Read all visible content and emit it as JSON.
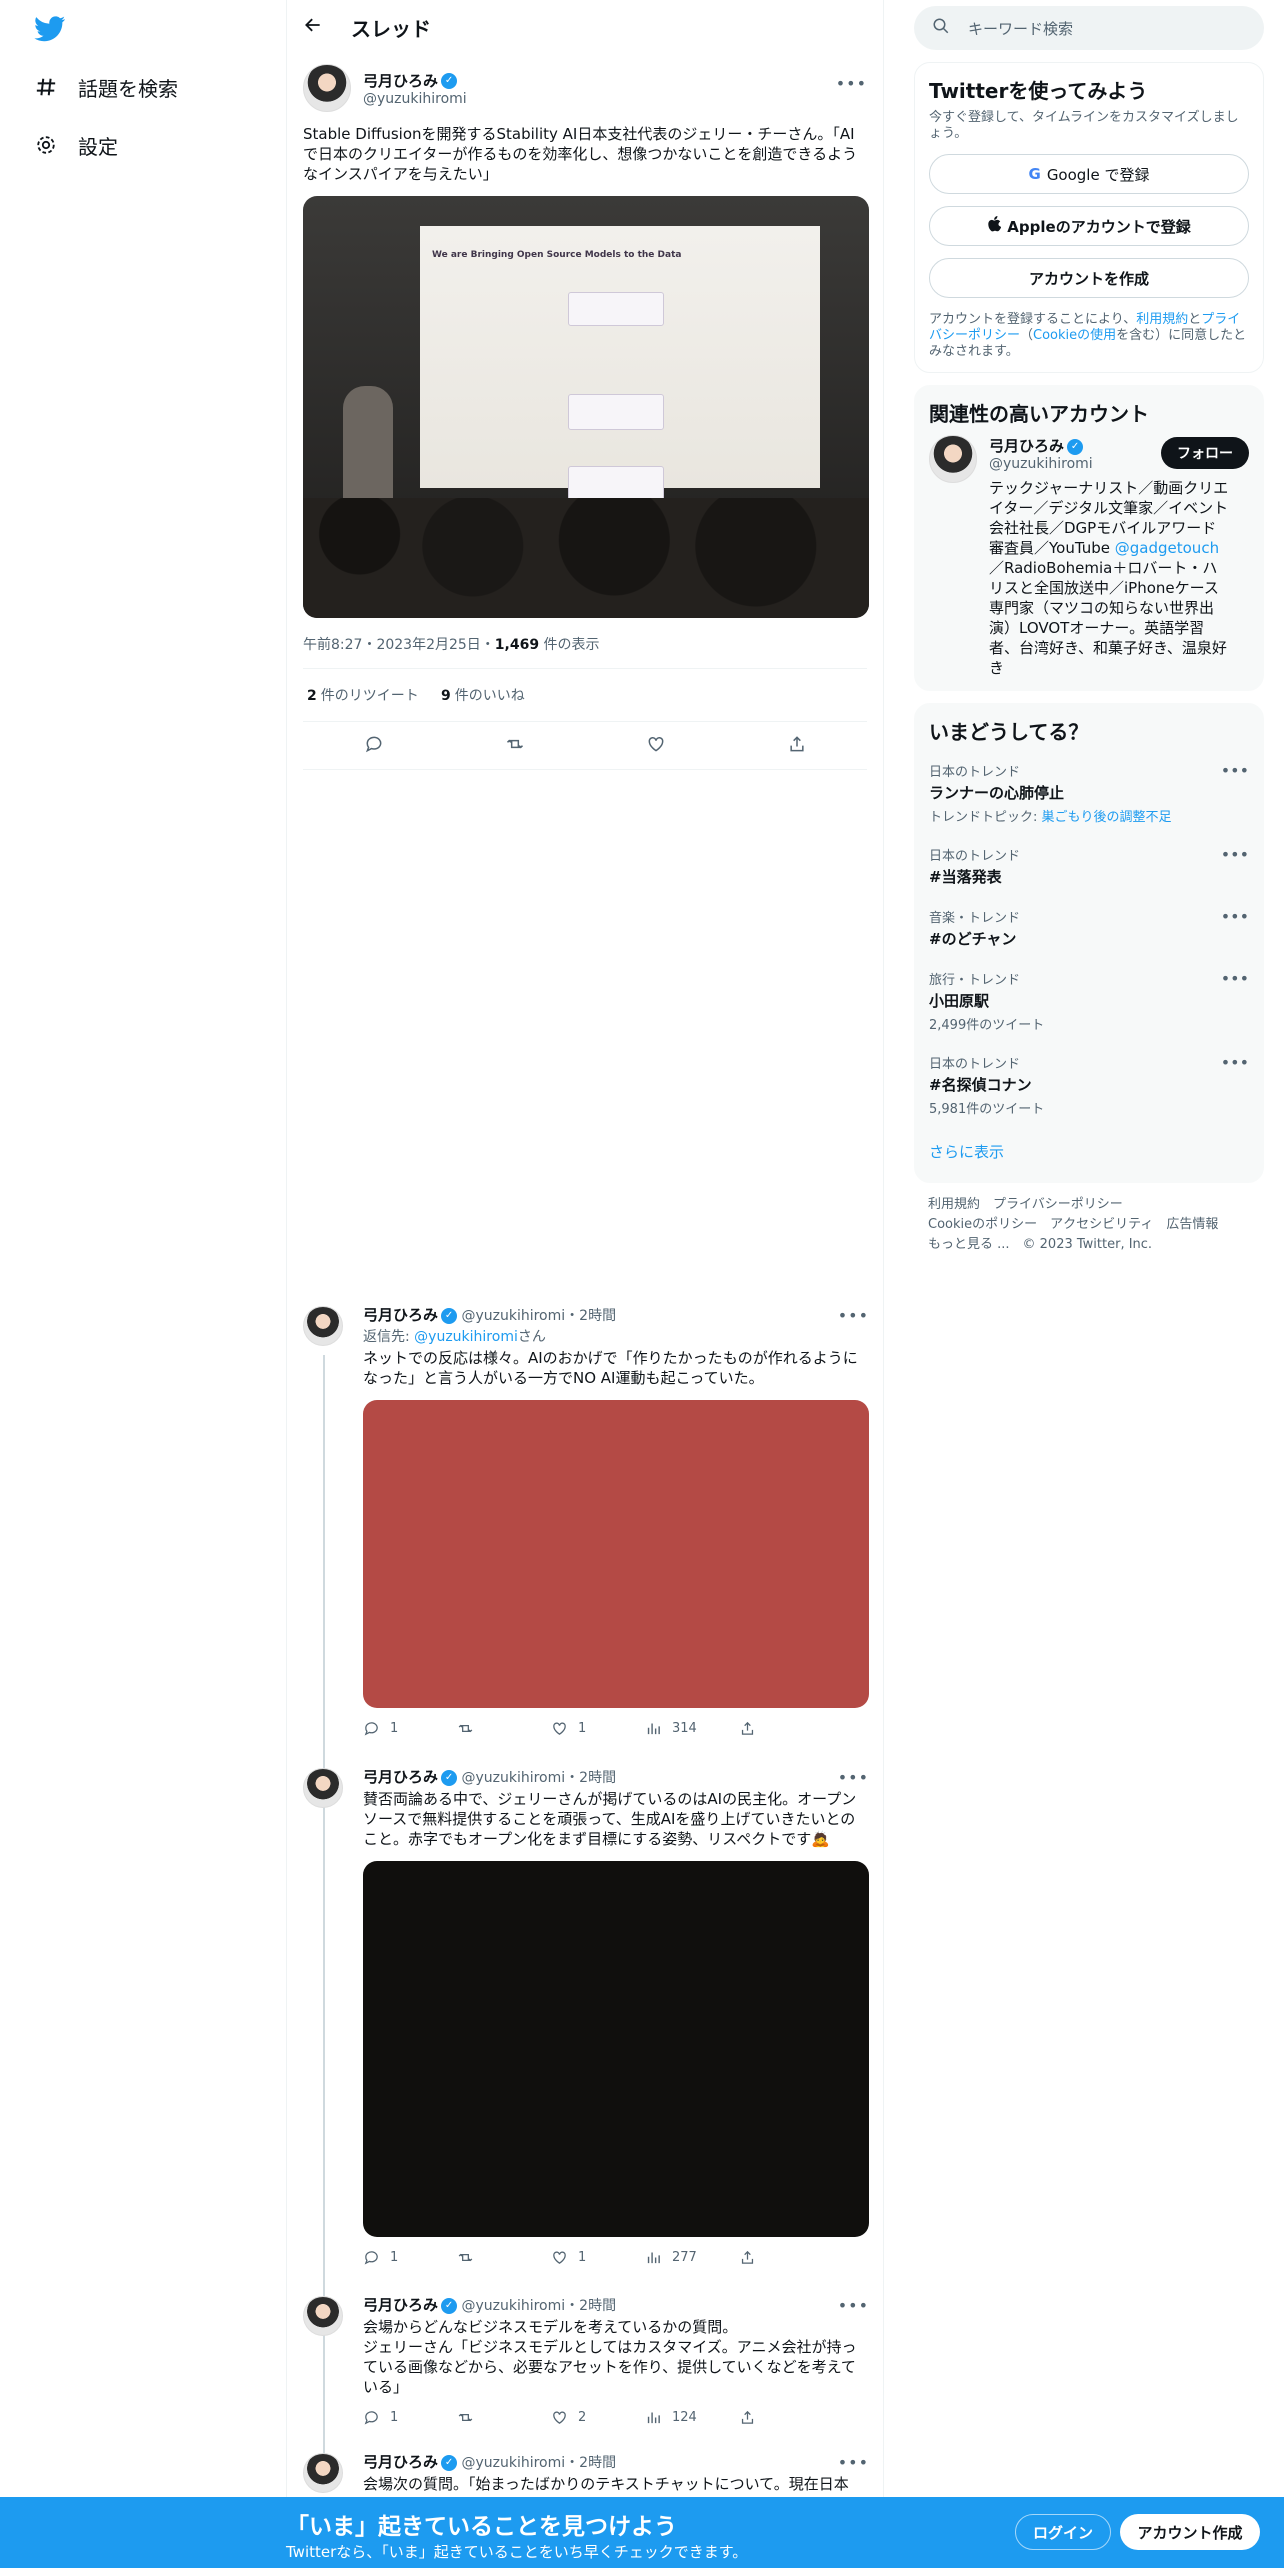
{
  "left_nav": {
    "items": [
      {
        "icon": "hash-icon",
        "label": "話題を検索"
      },
      {
        "icon": "gear-icon",
        "label": "設定"
      }
    ]
  },
  "header": {
    "title": "スレッド"
  },
  "main_tweet": {
    "name": "弓月ひろみ",
    "handle": "@yuzukihiromi",
    "text": "Stable Diffusionを開発するStability AI日本支社代表のジェリー・チーさん。「AIで日本のクリエイターが作るものを効率化し、想像つかないことを創造できるようなインスパイアを与えたい」",
    "slide_title": "We are Bringing Open Source Models to the Data",
    "time": "午前8:27・2023年2月25日",
    "views": "1,469",
    "views_label": "件の表示",
    "retweets": "2",
    "retweets_label": "件のリツイート",
    "likes": "9",
    "likes_label": "件のいいね"
  },
  "replies": [
    {
      "name": "弓月ひろみ",
      "handle": "@yuzukihiromi",
      "time": "2時間",
      "reply_to_prefix": "返信先:",
      "reply_to_handle": "@yuzukihiromi",
      "reply_to_suffix": "さん",
      "text": "ネットでの反応は様々。AIのおかげで「作りたかったものが作れるようになった」と言う人がいる一方でNO AI運動も起こっていた。",
      "replies": "1",
      "retweets": "",
      "likes": "1",
      "views": "314",
      "media_color": "#b44a45"
    },
    {
      "name": "弓月ひろみ",
      "handle": "@yuzukihiromi",
      "time": "2時間",
      "text": "賛否両論ある中で、ジェリーさんが掲げているのはAIの民主化。オープンソースで無料提供することを頑張って、生成AIを盛り上げていきたいとのこと。赤字でもオープン化をまず目標にする姿勢、リスペクトです🙇",
      "replies": "1",
      "retweets": "",
      "likes": "1",
      "views": "277",
      "media_color": "#100f0d"
    },
    {
      "name": "弓月ひろみ",
      "handle": "@yuzukihiromi",
      "time": "2時間",
      "text": "会場からどんなビジネスモデルを考えているかの質問。\nジェリーさん「ビジネスモデルとしてはカスタマイズ。アニメ会社が持っている画像などから、必要なアセットを作り、提供していくなどを考えている」",
      "replies": "1",
      "retweets": "",
      "likes": "2",
      "views": "124"
    },
    {
      "name": "弓月ひろみ",
      "handle": "@yuzukihiromi",
      "time": "2時間",
      "text": "会場次の質問。「始まったばかりのテキストチャットについて。現在日本"
    }
  ],
  "search": {
    "placeholder": "キーワード検索"
  },
  "signup": {
    "title": "Twitterを使ってみよう",
    "desc": "今すぐ登録して、タイムラインをカスタマイズしましょう。",
    "google": "Google で登録",
    "apple": "Appleのアカウントで登録",
    "create": "アカウントを作成",
    "legal_1": "アカウントを登録することにより、",
    "legal_terms": "利用規約",
    "legal_2": "と",
    "legal_privacy": "プライバシーポリシー",
    "legal_3": "（",
    "legal_cookie": "Cookieの使用",
    "legal_4": "を含む）に同意したとみなされます。"
  },
  "related": {
    "title": "関連性の高いアカウント",
    "name": "弓月ひろみ",
    "handle": "@yuzukihiromi",
    "follow": "フォロー",
    "bio_1": "テックジャーナリスト／動画クリエイター／デジタル文筆家／イベント会社社長／DGPモバイルアワード審査員／YouTube ",
    "bio_link": "@gadgetouch",
    "bio_2": "／RadioBohemia＋ロバート・ハリスと全国放送中／iPhoneケース専門家（マツコの知らない世界出演）LOVOTオーナー。英語学習者、台湾好き、和菓子好き、温泉好き"
  },
  "trends": {
    "title": "いまどうしてる？",
    "items": [
      {
        "category": "日本のトレンド",
        "name": "ランナーの心肺停止",
        "sub_prefix": "トレンドトピック: ",
        "sub_link": "巣ごもり後の調整不足",
        "sub": ""
      },
      {
        "category": "日本のトレンド",
        "name": "#当落発表",
        "sub": ""
      },
      {
        "category": "音楽・トレンド",
        "name": "#のどチャン",
        "sub": ""
      },
      {
        "category": "旅行・トレンド",
        "name": "小田原駅",
        "sub": "2,499件のツイート"
      },
      {
        "category": "日本のトレンド",
        "name": "#名探偵コナン",
        "sub": "5,981件のツイート"
      }
    ],
    "show_more": "さらに表示"
  },
  "footer": {
    "line1": "利用規約　プライバシーポリシー",
    "line2": "Cookieのポリシー　アクセシビリティ　広告情報",
    "line3": "もっと見る ...　© 2023 Twitter, Inc."
  },
  "bottom_bar": {
    "title": "「いま」起きていることを見つけよう",
    "subtitle": "Twitterなら、「いま」起きていることをいち早くチェックできます。",
    "login": "ログイン",
    "signup": "アカウント作成"
  },
  "colors": {
    "accent": "#1d9bf0",
    "bottom_bar": "#1d9bf0"
  }
}
